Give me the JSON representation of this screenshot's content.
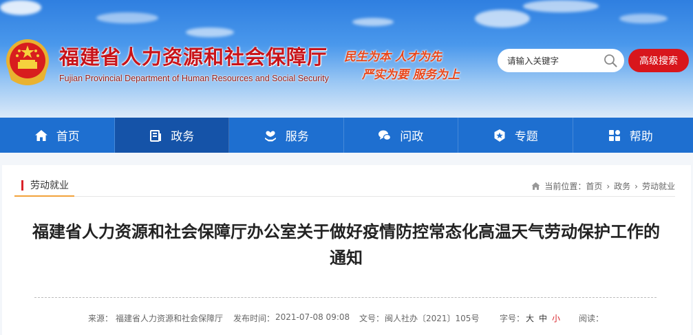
{
  "header": {
    "site_title": "福建省人力资源和社会保障厅",
    "site_subtitle": "Fujian Provincial Department of Human Resources and Social Security",
    "slogan_line1": "民生为本 人才为先",
    "slogan_line2": "严实为要 服务为上",
    "search": {
      "placeholder": "请输入关键字"
    },
    "advanced_search_label": "高级搜索"
  },
  "nav": {
    "items": [
      {
        "label": "首页",
        "icon": "home-icon"
      },
      {
        "label": "政务",
        "icon": "document-icon",
        "active": true
      },
      {
        "label": "服务",
        "icon": "service-icon"
      },
      {
        "label": "问政",
        "icon": "chat-icon"
      },
      {
        "label": "专题",
        "icon": "badge-icon"
      },
      {
        "label": "帮助",
        "icon": "grid-icon"
      }
    ],
    "colors": {
      "bar": "#1e6fd0",
      "active": "#1553a8"
    }
  },
  "section": {
    "tab_label": "劳动就业",
    "breadcrumb_prefix": "当前位置：",
    "breadcrumb": [
      "首页",
      "政务",
      "劳动就业"
    ]
  },
  "article": {
    "title": "福建省人力资源和社会保障厅办公室关于做好疫情防控常态化高温天气劳动保护工作的通知",
    "source_label": "来源：",
    "source": "福建省人力资源和社会保障厅",
    "date_label": "发布时间：",
    "date": "2021-07-08 09:08",
    "docno_label": "文号：",
    "docno": "闽人社办〔2021〕105号",
    "fontsize_label": "字号：",
    "fontsize_options": [
      "大",
      "中",
      "小"
    ],
    "reads_label": "阅读："
  },
  "colors": {
    "brand_red": "#d8161c",
    "title_red": "#c8141a",
    "accent_orange": "#f2a23a"
  }
}
